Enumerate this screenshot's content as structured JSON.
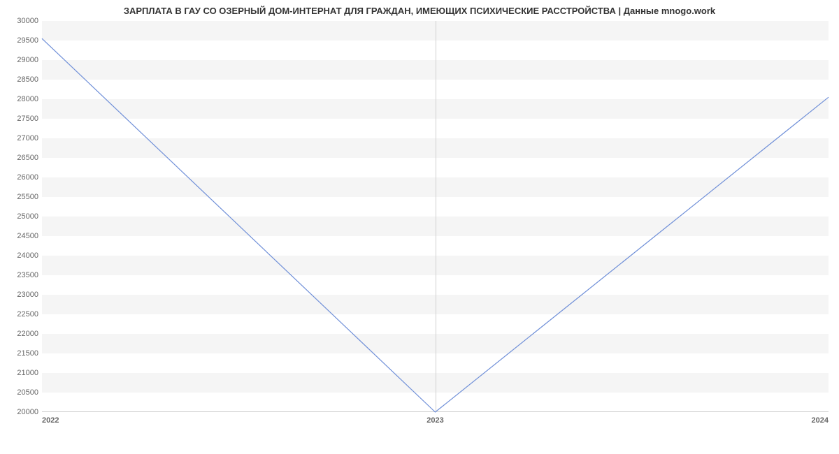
{
  "chart_data": {
    "type": "line",
    "title": "ЗАРПЛАТА В ГАУ СО ОЗЕРНЫЙ ДОМ-ИНТЕРНАТ ДЛЯ ГРАЖДАН, ИМЕЮЩИХ ПСИХИЧЕСКИЕ РАССТРОЙСТВА | Данные mnogo.work",
    "xlabel": "",
    "ylabel": "",
    "categories": [
      "2022",
      "2023",
      "2024"
    ],
    "values": [
      29550,
      20000,
      28050
    ],
    "ylim": [
      20000,
      30000
    ],
    "y_ticks": [
      20000,
      20500,
      21000,
      21500,
      22000,
      22500,
      23000,
      23500,
      24000,
      24500,
      25000,
      25500,
      26000,
      26500,
      27000,
      27500,
      28000,
      28500,
      29000,
      29500,
      30000
    ]
  }
}
